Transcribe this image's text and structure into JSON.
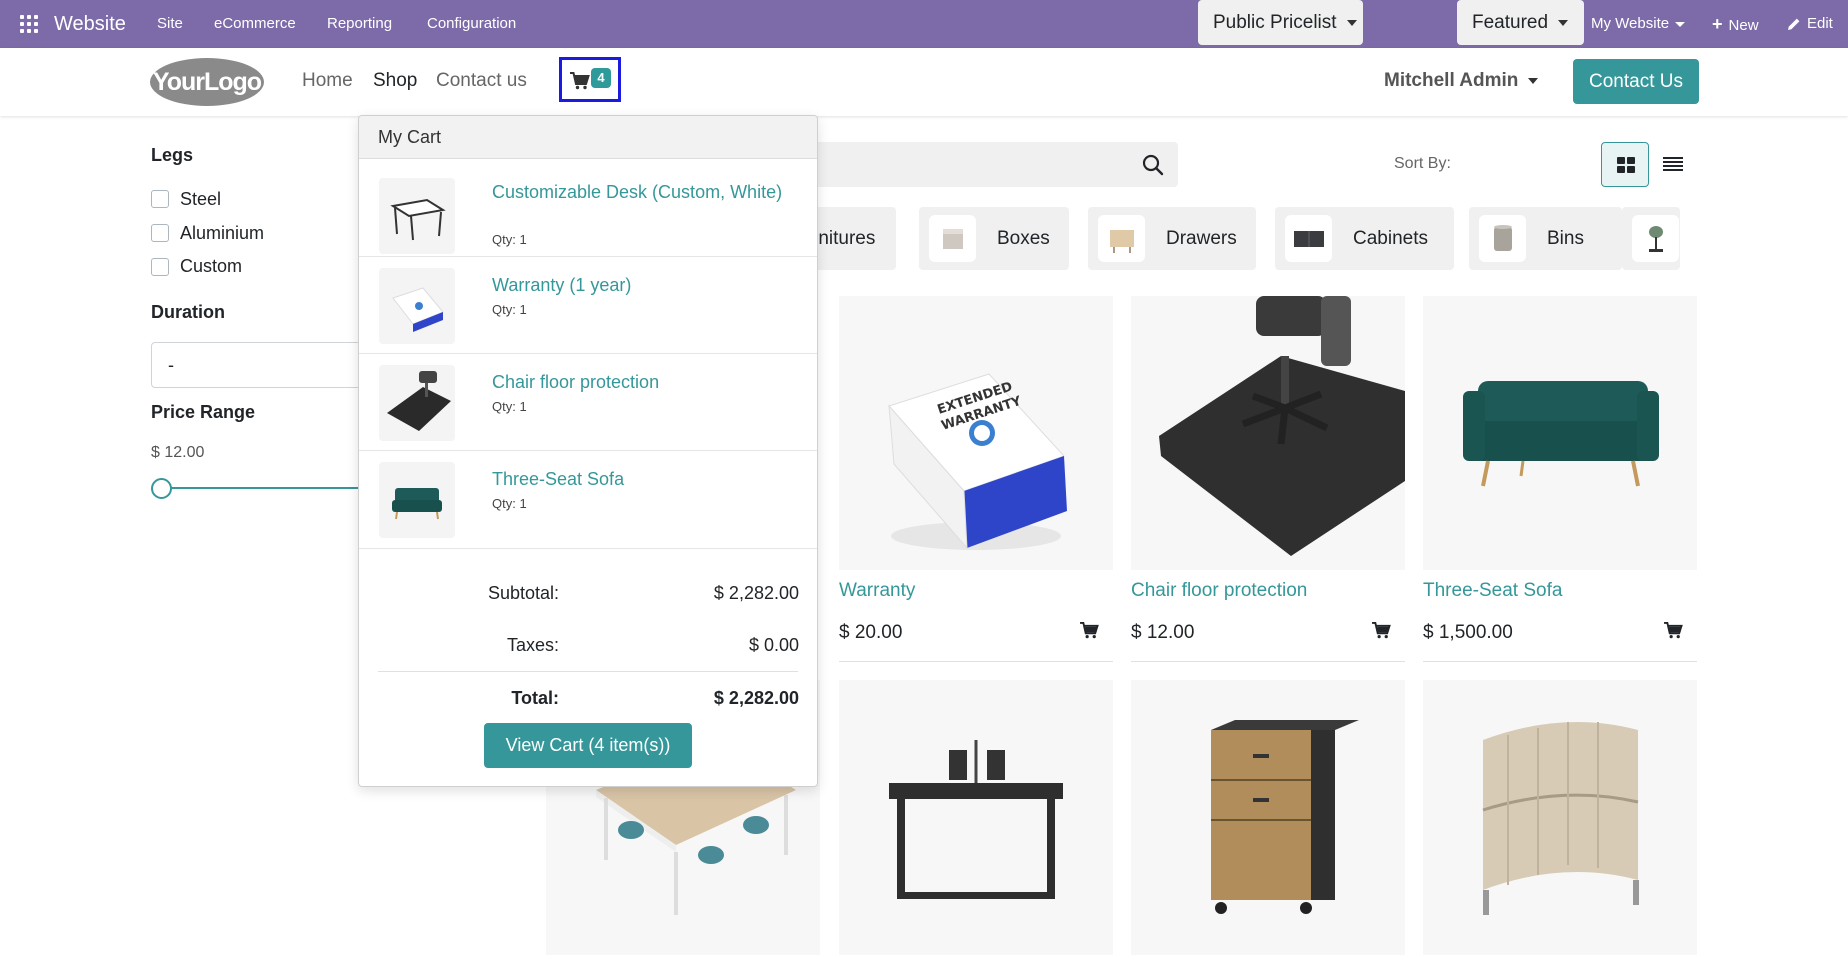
{
  "adminbar": {
    "brand": "Website",
    "menus": [
      "Site",
      "eCommerce",
      "Reporting",
      "Configuration"
    ],
    "website_selector": "My Website",
    "new_label": "New",
    "edit_label": "Edit"
  },
  "header": {
    "logo_text": "YourLogo",
    "nav": [
      "Home",
      "Shop",
      "Contact us"
    ],
    "cart_count": "4",
    "user": "Mitchell Admin",
    "contact_button": "Contact Us"
  },
  "filters": {
    "legs_title": "Legs",
    "legs_options": [
      "Steel",
      "Aluminium",
      "Custom"
    ],
    "duration_title": "Duration",
    "duration_value": "-",
    "price_title": "Price Range",
    "price_min": "$ 12.00"
  },
  "shopbar": {
    "pricelist": "Public Pricelist",
    "sort_label": "Sort By:",
    "sort_value": "Featured"
  },
  "categories": [
    "rnitures",
    "Boxes",
    "Drawers",
    "Cabinets",
    "Bins"
  ],
  "products": [
    {
      "name": "Warranty",
      "price": "$ 20.00"
    },
    {
      "name": "Chair floor protection",
      "price": "$ 12.00"
    },
    {
      "name": "Three-Seat Sofa",
      "price": "$ 1,500.00"
    }
  ],
  "cart": {
    "title": "My Cart",
    "items": [
      {
        "name": "Customizable Desk (Custom, White)",
        "qty": "Qty: 1"
      },
      {
        "name": "Warranty (1 year)",
        "qty": "Qty: 1"
      },
      {
        "name": "Chair floor protection",
        "qty": "Qty: 1"
      },
      {
        "name": "Three-Seat Sofa",
        "qty": "Qty: 1"
      }
    ],
    "subtotal_label": "Subtotal:",
    "subtotal_value": "$ 2,282.00",
    "taxes_label": "Taxes:",
    "taxes_value": "$ 0.00",
    "total_label": "Total:",
    "total_value": "$ 2,282.00",
    "view_cart": "View Cart (4 item(s))"
  },
  "colors": {
    "adminbar": "#7c6ba8",
    "accent": "#35979a",
    "cart_highlight": "#1b1be0"
  }
}
